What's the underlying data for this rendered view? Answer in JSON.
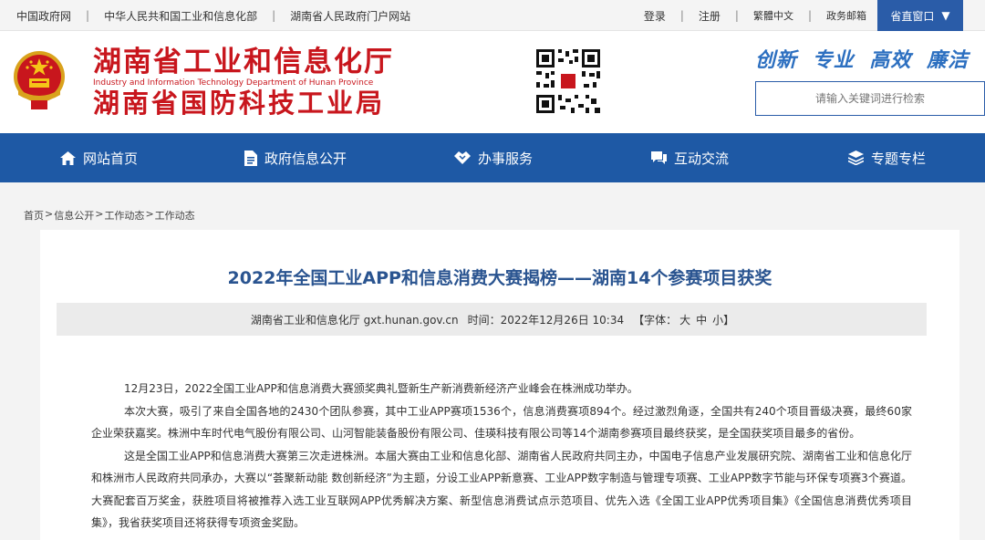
{
  "topbar": {
    "links": [
      "中国政府网",
      "中华人民共和国工业和信息化部",
      "湖南省人民政府门户网站"
    ],
    "login": "登录",
    "register": "注册",
    "traditional": "繁體中文",
    "email": "政务邮箱",
    "window_btn": "省直窗口",
    "sep": "|"
  },
  "header": {
    "title_cn": "湖南省工业和信息化厅",
    "title_en": "Industry and Information Technology Department of Hunan Province",
    "title_cn2": "湖南省国防科技工业局",
    "slogan": [
      "创新",
      "专业",
      "高效",
      "廉洁"
    ],
    "search_placeholder": "请输入关键词进行检索"
  },
  "nav": {
    "items": [
      "网站首页",
      "政府信息公开",
      "办事服务",
      "互动交流",
      "专题专栏"
    ]
  },
  "breadcrumb": [
    "首页",
    "信息公开",
    "工作动态",
    "工作动态"
  ],
  "breadcrumb_sep": ">",
  "article": {
    "title": "2022年全国工业APP和信息消费大赛揭榜——湖南14个参赛项目获奖",
    "source": "湖南省工业和信息化厅 gxt.hunan.gov.cn",
    "time": "时间：2022年12月26日 10:34",
    "font_size_label": "【字体：",
    "font_big": "大",
    "font_mid": "中",
    "font_small": "小】",
    "paragraphs": [
      "12月23日，2022全国工业APP和信息消费大赛颁奖典礼暨新生产新消费新经济产业峰会在株洲成功举办。",
      "本次大赛，吸引了来自全国各地的2430个团队参赛，其中工业APP赛项1536个，信息消费赛项894个。经过激烈角逐，全国共有240个项目晋级决赛，最终60家企业荣获嘉奖。株洲中车时代电气股份有限公司、山河智能装备股份有限公司、佳瑛科技有限公司等14个湖南参赛项目最终获奖，是全国获奖项目最多的省份。",
      "这是全国工业APP和信息消费大赛第三次走进株洲。本届大赛由工业和信息化部、湖南省人民政府共同主办，中国电子信息产业发展研究院、湖南省工业和信息化厅和株洲市人民政府共同承办，大赛以“荟聚新动能 数创新经济”为主题，分设工业APP新意赛、工业APP数字制造与管理专项赛、工业APP数字节能与环保专项赛3个赛道。大赛配套百万奖金，获胜项目将被推荐入选工业互联网APP优秀解决方案、新型信息消费试点示范项目、优先入选《全国工业APP优秀项目集》《全国信息消费优秀项目集》，我省获奖项目还将获得专项资金奖励。"
    ]
  },
  "colors": {
    "brand_red": "#c8161d",
    "nav_blue": "#1e59a5",
    "title_blue": "#2a5490"
  }
}
